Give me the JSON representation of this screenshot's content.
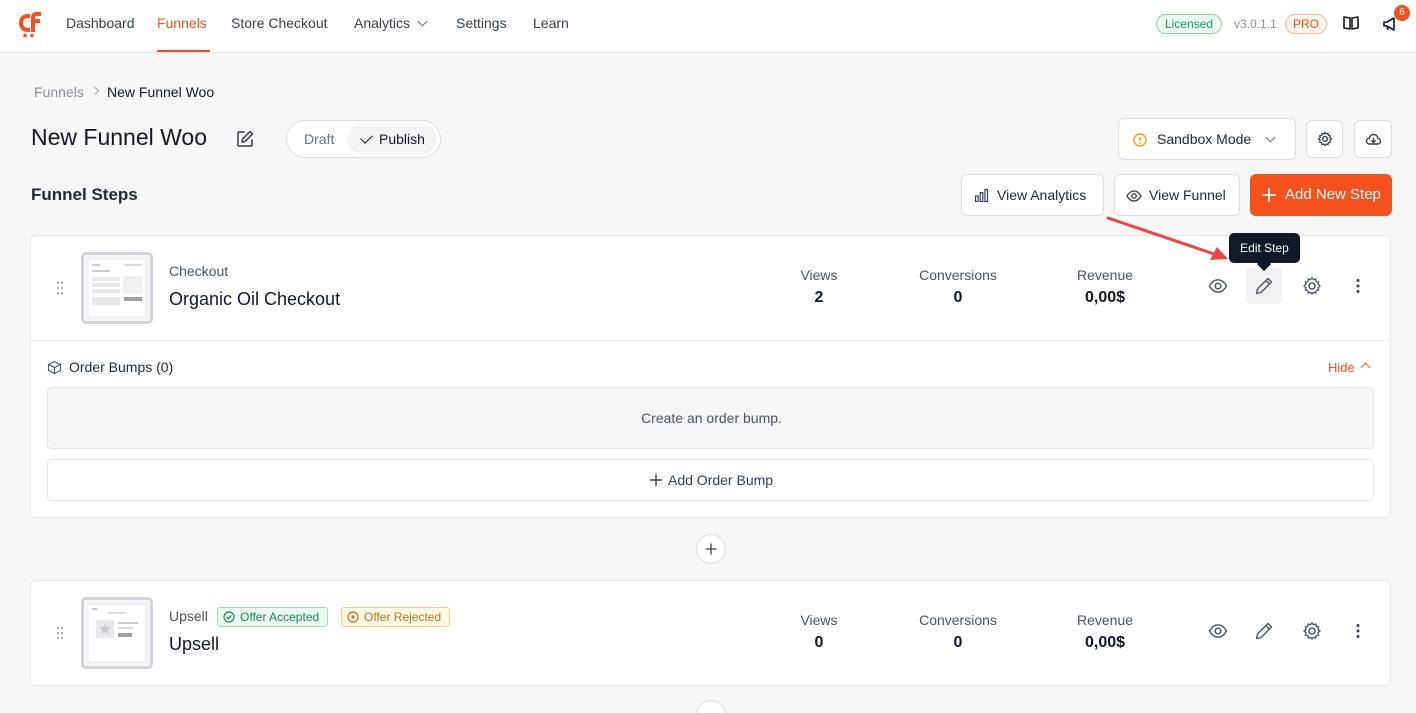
{
  "nav": {
    "items": [
      "Dashboard",
      "Funnels",
      "Store Checkout",
      "Analytics",
      "Settings",
      "Learn"
    ],
    "license_badge": "Licensed",
    "version": "v3.0.1.1",
    "pro_badge": "PRO",
    "notification_count": "6"
  },
  "breadcrumb": {
    "root": "Funnels",
    "current": "New Funnel Woo"
  },
  "header": {
    "title": "New Funnel Woo",
    "status_draft": "Draft",
    "status_publish": "Publish",
    "sandbox_label": "Sandbox Mode"
  },
  "steps_section": {
    "title": "Funnel Steps",
    "view_analytics": "View Analytics",
    "view_funnel": "View Funnel",
    "add_new_step": "Add New Step"
  },
  "steps": [
    {
      "type": "Checkout",
      "name": "Organic Oil Checkout",
      "stats": {
        "views_label": "Views",
        "views": "2",
        "conversions_label": "Conversions",
        "conversions": "0",
        "revenue_label": "Revenue",
        "revenue": "0,00$"
      },
      "tooltip": "Edit Step",
      "order_bumps": {
        "title": "Order Bumps (0)",
        "hide_label": "Hide",
        "empty_text": "Create an order bump.",
        "add_label": "Add Order Bump"
      }
    },
    {
      "type": "Upsell",
      "name": "Upsell",
      "tags": [
        "Offer Accepted",
        "Offer Rejected"
      ],
      "stats": {
        "views_label": "Views",
        "views": "0",
        "conversions_label": "Conversions",
        "conversions": "0",
        "revenue_label": "Revenue",
        "revenue": "0,00$"
      }
    }
  ],
  "colors": {
    "brand": "#f4511e",
    "success": "#1a9e55",
    "warning": "#b7791f"
  },
  "icons": [
    "logo-icon",
    "book-icon",
    "megaphone-icon",
    "edit-icon",
    "sandbox-info-icon",
    "gear-icon",
    "cloud-download-icon",
    "bar-chart-icon",
    "eye-icon",
    "plus-icon",
    "drag-handle-icon",
    "pencil-icon",
    "more-vertical-icon",
    "box-icon",
    "check-circle-icon",
    "x-circle-icon"
  ]
}
